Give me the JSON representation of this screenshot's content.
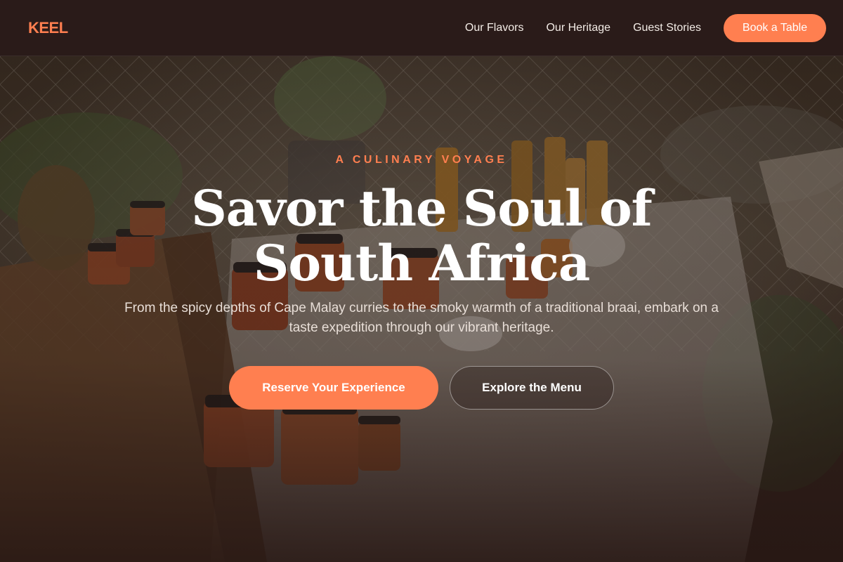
{
  "colors": {
    "accent": "#ff7f50",
    "nav_background": "#2a1b19",
    "text_light": "#f3ece6"
  },
  "nav": {
    "logo": "KEEL",
    "links": [
      "Our Flavors",
      "Our Heritage",
      "Guest Stories"
    ],
    "cta_label": "Book a Table"
  },
  "hero": {
    "eyebrow": "A CULINARY VOYAGE",
    "headline": "Savor the Soul of South Africa",
    "subtext": "From the spicy depths of Cape Malay curries to the smoky warmth of a traditional braai, embark on a taste expedition through our vibrant heritage.",
    "primary_button": "Reserve Your Experience",
    "secondary_button": "Explore the Menu",
    "background_image": "market-table-jars-photo"
  }
}
